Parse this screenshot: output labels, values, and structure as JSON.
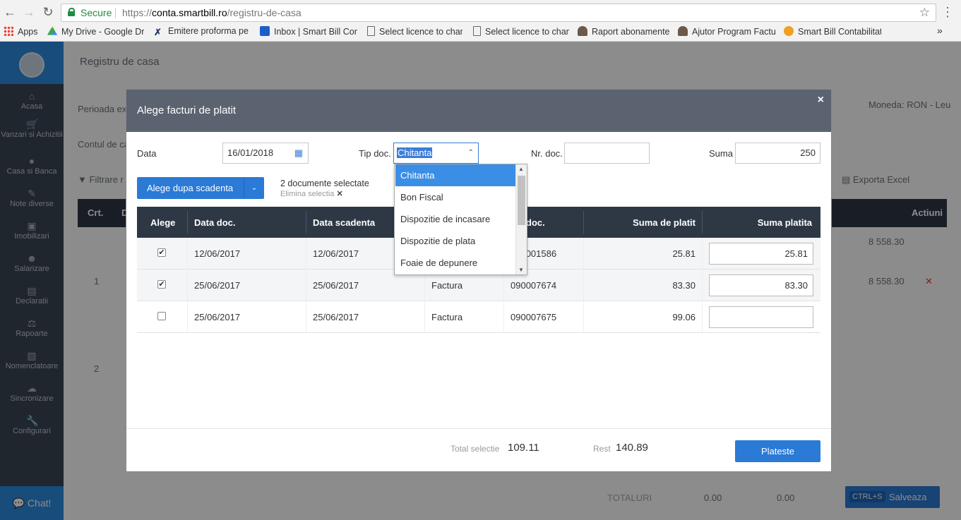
{
  "browser": {
    "secure_label": "Secure",
    "url_scheme": "https://",
    "url_host": "conta.smartbill.ro",
    "url_path": "/registru-de-casa",
    "bookmarks": [
      "Apps",
      "My Drive - Google Dr",
      "Emitere proforma pe",
      "Inbox | Smart Bill Con",
      "Select licence to chan",
      "Select licence to chan",
      "Raport abonamente",
      "Ajutor Program Factu",
      "Smart Bill Contabilitat"
    ]
  },
  "sidebar": {
    "items": [
      {
        "label": "Acasa",
        "icon": "home-icon"
      },
      {
        "label": "Vanzari si Achizitii",
        "icon": "cart-icon"
      },
      {
        "label": "Casa si Banca",
        "icon": "piggy-bank-icon"
      },
      {
        "label": "Note diverse",
        "icon": "edit-icon"
      },
      {
        "label": "Imobilizari",
        "icon": "car-icon"
      },
      {
        "label": "Salarizare",
        "icon": "people-icon"
      },
      {
        "label": "Declaratii",
        "icon": "document-icon"
      },
      {
        "label": "Rapoarte",
        "icon": "scale-icon"
      },
      {
        "label": "Nomenclatoare",
        "icon": "book-icon"
      },
      {
        "label": "Sincronizare",
        "icon": "cloud-icon"
      },
      {
        "label": "Configurari",
        "icon": "wrench-icon"
      }
    ],
    "chat_label": "Chat!"
  },
  "page": {
    "title": "Registru de casa",
    "perioada": "Perioada ex",
    "contul": "Contul de ca",
    "filtrare": "Filtrare r",
    "moneda": "Moneda: RON - Leu",
    "exporta": "Exporta Excel",
    "crt": "Crt.",
    "d_col": "D",
    "actiuni": "Actiuni",
    "row_amount_top": "8 558.30",
    "row_amount": "8 558.30",
    "row1_num": "1",
    "row2_num": "2",
    "totaluri": "TOTALURI",
    "total1": "0.00",
    "total2": "0.00",
    "save_shortcut": "CTRL+S",
    "save_label": "Salveaza"
  },
  "modal": {
    "title": "Alege facturi de platit",
    "close": "×",
    "data_label": "Data",
    "data_value": "16/01/2018",
    "tipdoc_label": "Tip doc.",
    "tipdoc_value": "Chitanta",
    "nrdoc_label": "Nr. doc.",
    "nrdoc_value": "",
    "suma_label": "Suma",
    "suma_value": "250",
    "dropdown_options": [
      "Chitanta",
      "Bon Fiscal",
      "Dispozitie de incasare",
      "Dispozitie de plata",
      "Foaie de depunere"
    ],
    "alege_btn": "Alege dupa scadenta",
    "docs_selected": "2 documente selectate",
    "elimina": "Elimina selectia",
    "columns": [
      "Alege",
      "Data doc.",
      "Data scadenta",
      "",
      "doc.",
      "Suma de platit",
      "Suma platita"
    ],
    "rows": [
      {
        "checked": true,
        "data_doc": "12/06/2017",
        "data_scadenta": "12/06/2017",
        "tip": "",
        "nr": "090001586",
        "suma_platit": "25.81",
        "suma_platita": "25.81"
      },
      {
        "checked": true,
        "data_doc": "25/06/2017",
        "data_scadenta": "25/06/2017",
        "tip": "Factura",
        "nr": "090007674",
        "suma_platit": "83.30",
        "suma_platita": "83.30"
      },
      {
        "checked": false,
        "data_doc": "25/06/2017",
        "data_scadenta": "25/06/2017",
        "tip": "Factura",
        "nr": "090007675",
        "suma_platit": "99.06",
        "suma_platita": ""
      }
    ],
    "total_selectie_label": "Total selectie",
    "total_selectie": "109.11",
    "rest_label": "Rest",
    "rest": "140.89",
    "plateste": "Plateste"
  }
}
